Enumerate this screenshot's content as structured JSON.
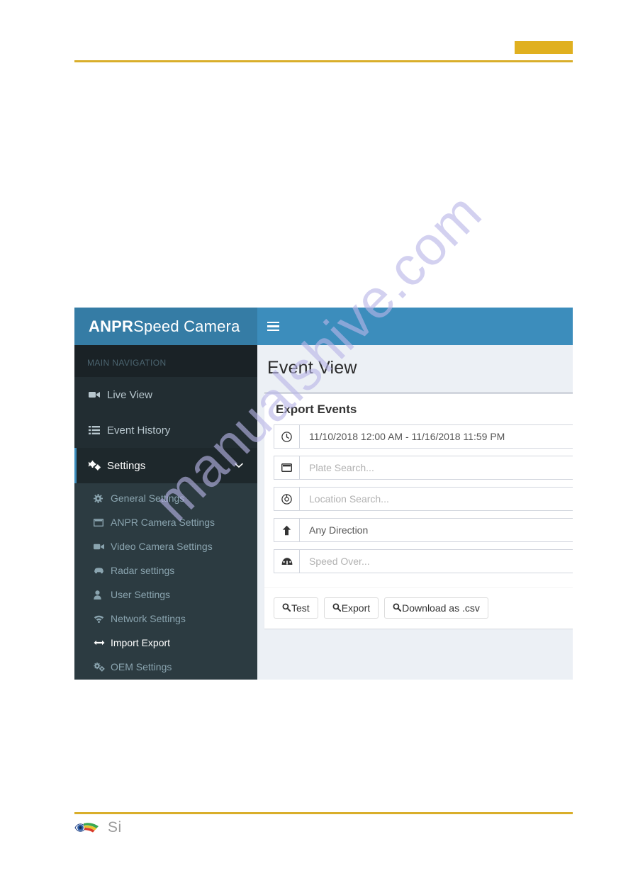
{
  "manual_page": {
    "top_swatch_color": "#e0b020",
    "rule_color": "#d9ae2a",
    "footer_logo_text": "Si"
  },
  "watermark": {
    "text": "manualshive.com",
    "color": "#b9b6e8"
  },
  "app": {
    "logo": {
      "bold": "ANPR",
      "regular": "Speed Camera"
    },
    "navbar": {
      "toggle_icon": "hamburger-icon"
    },
    "colors": {
      "header": "#3c8dbc",
      "logo_bg": "#357ca5",
      "sidebar": "#222d32",
      "submenu": "#2c3b41",
      "content_bg": "#ecf0f5"
    },
    "sidebar": {
      "heading": "MAIN NAVIGATION",
      "items": [
        {
          "label": "Live View",
          "icon": "video-camera-icon",
          "active": false
        },
        {
          "label": "Event History",
          "icon": "list-icon",
          "active": false
        },
        {
          "label": "Settings",
          "icon": "gears-icon",
          "active": true,
          "caret": "∨"
        }
      ],
      "submenu": [
        {
          "label": "General Settings",
          "icon": "gear-icon",
          "active": false
        },
        {
          "label": "ANPR Camera Settings",
          "icon": "window-icon",
          "active": false
        },
        {
          "label": "Video Camera Settings",
          "icon": "video-camera-icon",
          "active": false
        },
        {
          "label": "Radar settings",
          "icon": "car-icon",
          "active": false
        },
        {
          "label": "User Settings",
          "icon": "user-icon",
          "active": false
        },
        {
          "label": "Network Settings",
          "icon": "wifi-icon",
          "active": false
        },
        {
          "label": "Import Export",
          "icon": "arrows-h-icon",
          "active": true
        },
        {
          "label": "OEM Settings",
          "icon": "gears-icon",
          "active": false
        }
      ]
    },
    "content": {
      "page_title": "Event View",
      "panel": {
        "title": "Export Events",
        "fields": [
          {
            "name": "date-range",
            "icon": "clock-icon",
            "value": "11/10/2018 12:00 AM - 11/16/2018 11:59 PM",
            "is_placeholder": false
          },
          {
            "name": "plate-search",
            "icon": "plate-icon",
            "value": "Plate Search...",
            "is_placeholder": true
          },
          {
            "name": "location-search",
            "icon": "crosshair-icon",
            "value": "Location Search...",
            "is_placeholder": true
          },
          {
            "name": "direction-select",
            "icon": "arrow-up-icon",
            "value": "Any Direction",
            "is_placeholder": false
          },
          {
            "name": "speed-over",
            "icon": "tachometer-icon",
            "value": "Speed Over...",
            "is_placeholder": true
          }
        ],
        "buttons": [
          {
            "name": "test-button",
            "icon": "search-icon",
            "label": "Test"
          },
          {
            "name": "export-button",
            "icon": "search-icon",
            "label": "Export"
          },
          {
            "name": "download-csv-button",
            "icon": "search-icon",
            "label": "Download as .csv"
          }
        ]
      }
    }
  }
}
